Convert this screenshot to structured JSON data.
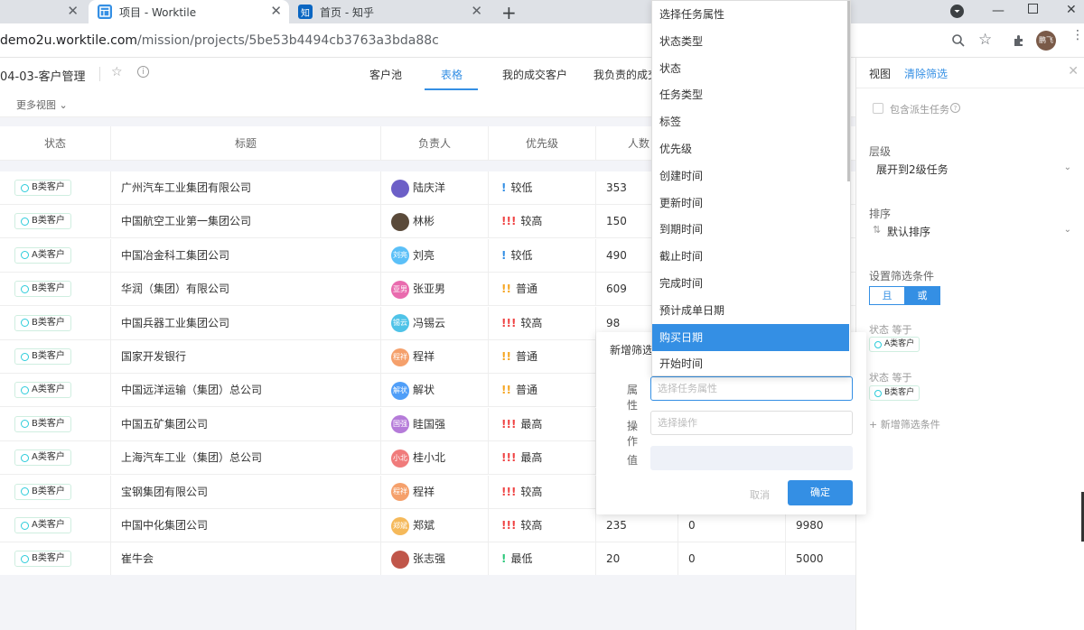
{
  "browser": {
    "tabs": [
      {
        "title": "",
        "icon": "blank-tab"
      },
      {
        "title": "项目 - Worktile",
        "icon": "worktile-icon"
      },
      {
        "title": "首页 - 知乎",
        "icon": "zhihu-icon",
        "favicon_text": "知"
      }
    ],
    "new_tab": "+",
    "url_main": "demo2u.worktile.com",
    "url_path": "/mission/projects/5be53b4494cb3763a3bda88c",
    "profile_name": "鹏飞"
  },
  "header": {
    "project_name": "04-03-客户管理",
    "view_tabs": [
      "客户池",
      "表格",
      "我的成交客户",
      "我负责的成交"
    ],
    "active_tab": "表格",
    "more_views": "更多视图"
  },
  "table": {
    "columns": [
      "状态",
      "标题",
      "负责人",
      "优先级",
      "人数"
    ],
    "rows": [
      {
        "status": "B类客户",
        "title": "广州汽车工业集团有限公司",
        "owner": "陆庆洋",
        "avatar_text": "",
        "avatar_color": "#6c5fc7",
        "priority_mark": "!",
        "priority": "较低",
        "priority_color": "#348fe4",
        "count": "353",
        "c6": "",
        "c7": ""
      },
      {
        "status": "B类客户",
        "title": "中国航空工业第一集团公司",
        "owner": "林彬",
        "avatar_text": "",
        "avatar_color": "#5a4a3a",
        "priority_mark": "!!!",
        "priority": "较高",
        "priority_color": "#ef4444",
        "count": "150",
        "c6": "",
        "c7": ""
      },
      {
        "status": "A类客户",
        "title": "中国冶金科工集团公司",
        "owner": "刘亮",
        "avatar_text": "刘亮",
        "avatar_color": "#5bc0f8",
        "priority_mark": "!",
        "priority": "较低",
        "priority_color": "#348fe4",
        "count": "490",
        "c6": "",
        "c7": ""
      },
      {
        "status": "B类客户",
        "title": "华润（集团）有限公司",
        "owner": "张亚男",
        "avatar_text": "亚男",
        "avatar_color": "#e96bae",
        "priority_mark": "!!",
        "priority": "普通",
        "priority_color": "#f5a623",
        "count": "609",
        "c6": "",
        "c7": ""
      },
      {
        "status": "B类客户",
        "title": "中国兵器工业集团公司",
        "owner": "冯锡云",
        "avatar_text": "锡云",
        "avatar_color": "#4fc3e8",
        "priority_mark": "!!!",
        "priority": "较高",
        "priority_color": "#ef4444",
        "count": "98",
        "c6": "",
        "c7": ""
      },
      {
        "status": "B类客户",
        "title": "国家开发银行",
        "owner": "程祥",
        "avatar_text": "程祥",
        "avatar_color": "#f5a06b",
        "priority_mark": "!!",
        "priority": "普通",
        "priority_color": "#f5a623",
        "count": "",
        "c6": "",
        "c7": ""
      },
      {
        "status": "A类客户",
        "title": "中国远洋运输（集团）总公司",
        "owner": "解状",
        "avatar_text": "解状",
        "avatar_color": "#4f9ef8",
        "priority_mark": "!!",
        "priority": "普通",
        "priority_color": "#f5a623",
        "count": "",
        "c6": "",
        "c7": ""
      },
      {
        "status": "B类客户",
        "title": "中国五矿集团公司",
        "owner": "眭国强",
        "avatar_text": "国强",
        "avatar_color": "#b57bd9",
        "priority_mark": "!!!",
        "priority": "最高",
        "priority_color": "#ef4444",
        "count": "",
        "c6": "",
        "c7": ""
      },
      {
        "status": "A类客户",
        "title": "上海汽车工业（集团）总公司",
        "owner": "桂小北",
        "avatar_text": "小北",
        "avatar_color": "#f07b7b",
        "priority_mark": "!!!",
        "priority": "最高",
        "priority_color": "#ef4444",
        "count": "",
        "c6": "",
        "c7": ""
      },
      {
        "status": "B类客户",
        "title": "宝钢集团有限公司",
        "owner": "程祥",
        "avatar_text": "程祥",
        "avatar_color": "#f5a06b",
        "priority_mark": "!!!",
        "priority": "较高",
        "priority_color": "#ef4444",
        "count": "",
        "c6": "",
        "c7": ""
      },
      {
        "status": "A类客户",
        "title": "中国中化集团公司",
        "owner": "郑斌",
        "avatar_text": "郑斌",
        "avatar_color": "#f5b95a",
        "priority_mark": "!!!",
        "priority": "较高",
        "priority_color": "#ef4444",
        "count": "235",
        "c6": "0",
        "c7": "9980"
      },
      {
        "status": "B类客户",
        "title": "崔牛会",
        "owner": "张志强",
        "avatar_text": "",
        "avatar_color": "#c0564a",
        "priority_mark": "!",
        "priority": "最低",
        "priority_color": "#2cc77a",
        "count": "20",
        "c6": "0",
        "c7": "5000"
      }
    ]
  },
  "dropdown": {
    "items": [
      "选择任务属性",
      "状态类型",
      "状态",
      "任务类型",
      "标签",
      "优先级",
      "创建时间",
      "更新时间",
      "到期时间",
      "截止时间",
      "完成时间",
      "预计成单日期",
      "购买日期",
      "开始时间"
    ],
    "selected": "购买日期"
  },
  "filter_dialog": {
    "title": "新增筛选",
    "attr_label": "属性",
    "attr_placeholder": "选择任务属性",
    "op_label": "操作",
    "op_placeholder": "选择操作",
    "value_label": "值",
    "cancel": "取消",
    "confirm": "确定"
  },
  "right_panel": {
    "title": "视图",
    "clear": "清除筛选",
    "include_derived": "包含派生任务",
    "level_label": "层级",
    "level_value": "展开到2级任务",
    "sort_label": "排序",
    "sort_value": "默认排序",
    "filter_label": "设置筛选条件",
    "logic_and": "且",
    "logic_or": "或",
    "logic_selected": "或",
    "conditions": [
      {
        "label": "状态 等于",
        "value": "A类客户"
      },
      {
        "label": "状态 等于",
        "value": "B类客户"
      }
    ],
    "add_condition": "新增筛选条件"
  },
  "colors": {
    "accent": "#348fe4",
    "status_ring": "#2cccda"
  }
}
